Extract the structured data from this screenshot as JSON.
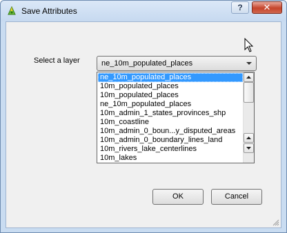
{
  "window": {
    "title": "Save Attributes",
    "help_label": "?",
    "close_label": "✕"
  },
  "form": {
    "layer_label": "Select a layer",
    "selected_layer": "ne_10m_populated_places"
  },
  "dropdown": {
    "items": [
      "ne_10m_populated_places",
      "10m_populated_places",
      "10m_populated_places",
      "ne_10m_populated_places",
      "10m_admin_1_states_provinces_shp",
      "10m_coastline",
      "10m_admin_0_boun...y_disputed_areas",
      "10m_admin_0_boundary_lines_land",
      "10m_rivers_lake_centerlines",
      "10m_lakes"
    ],
    "highlighted_index": 0
  },
  "buttons": {
    "ok_label": "OK",
    "cancel_label": "Cancel"
  },
  "colors": {
    "selection": "#3399ff",
    "title_bar": "#c9dcf1",
    "close_button": "#c6442a"
  }
}
